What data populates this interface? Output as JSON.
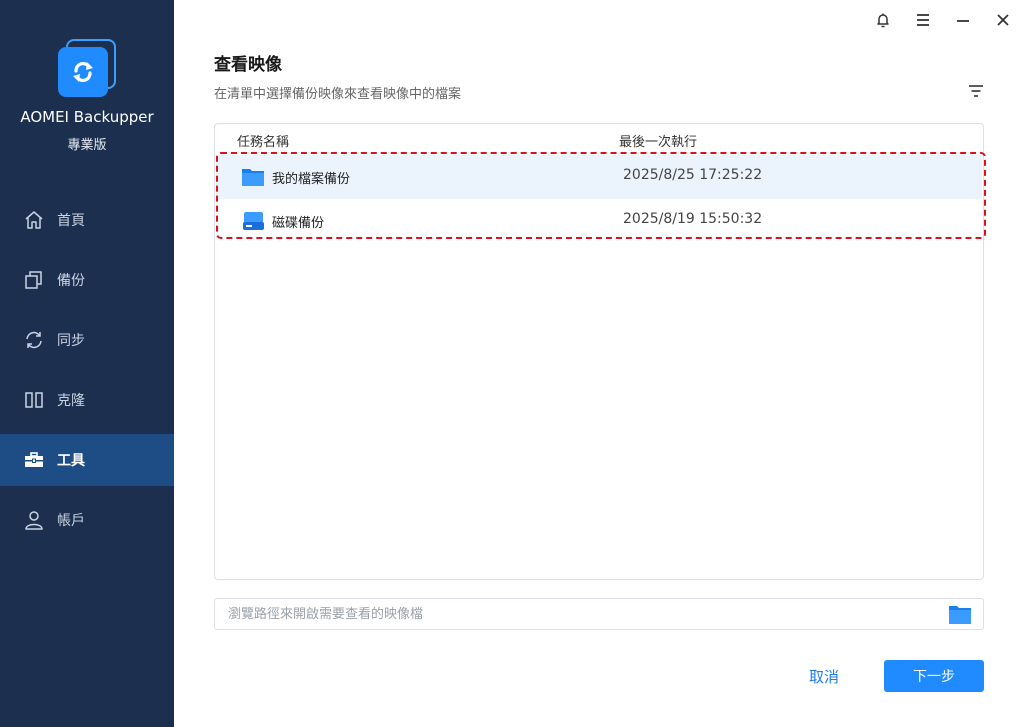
{
  "app": {
    "name": "AOMEI Backupper",
    "edition": "專業版"
  },
  "sidebar": {
    "items": [
      {
        "label": "首頁",
        "icon": "home-icon"
      },
      {
        "label": "備份",
        "icon": "backup-icon"
      },
      {
        "label": "同步",
        "icon": "sync-icon"
      },
      {
        "label": "克隆",
        "icon": "clone-icon"
      },
      {
        "label": "工具",
        "icon": "toolbox-icon",
        "active": true
      },
      {
        "label": "帳戶",
        "icon": "user-icon"
      }
    ]
  },
  "titlebar": {
    "icons": [
      "bell-icon",
      "menu-icon",
      "minimize-icon",
      "close-icon"
    ]
  },
  "main": {
    "title": "查看映像",
    "subtitle": "在清單中選擇備份映像來查看映像中的檔案",
    "list": {
      "columns": [
        "任務名稱",
        "最後一次執行"
      ],
      "rows": [
        {
          "name": "我的檔案備份",
          "time": "2025/8/25 17:25:22",
          "icon": "folder-icon",
          "selected": true
        },
        {
          "name": "磁碟備份",
          "time": "2025/8/19 15:50:32",
          "icon": "disk-icon",
          "selected": false
        }
      ]
    },
    "path_input": {
      "placeholder": "瀏覽路徑來開啟需要查看的映像檔",
      "value": ""
    },
    "buttons": {
      "cancel": "取消",
      "next": "下一步"
    }
  },
  "colors": {
    "sidebar_bg": "#1c2f4f",
    "sidebar_active": "#1e4d86",
    "accent": "#1f8bff",
    "highlight_dash": "#d8111e"
  }
}
